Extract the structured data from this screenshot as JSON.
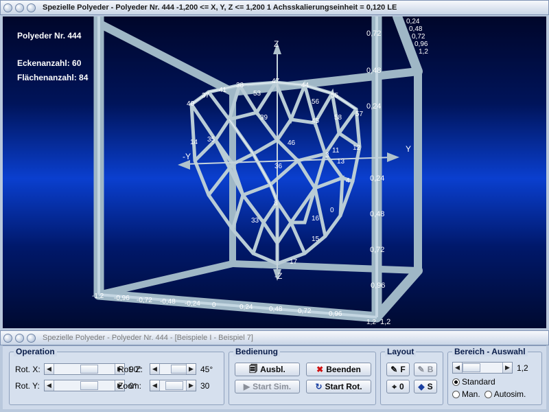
{
  "window": {
    "title": "Spezielle Polyeder - Polyeder Nr. 444   -1,200 <= X, Y, Z <= 1,200    1 Achsskalierungseinheit = 0,120 LE"
  },
  "info": {
    "polyeder": "Polyeder Nr. 444",
    "ecken": "Eckenanzahl: 60",
    "flaechen": "Flächenanzahl: 84"
  },
  "axes": {
    "y_label": "Y",
    "neg_y_label": "-Y",
    "z_label": "Z",
    "neg_z_label": "-Z",
    "right_ticks": [
      "0,72",
      "0,48",
      "0,24",
      "0,24",
      "0,48",
      "0,72",
      "0,96",
      "1,2"
    ],
    "top_right_ticks": [
      "0,24",
      "0,48",
      "0,72",
      "0,96",
      "1,2"
    ],
    "bottom_ticks": [
      "-1,2",
      "-0,96",
      "-0,72",
      "-0,48",
      "-0,24",
      "0",
      "0,24",
      "0,48",
      "0,72",
      "0,96",
      "1,2"
    ]
  },
  "vertex_labels": [
    "37",
    "41",
    "38",
    "53",
    "47",
    "44",
    "55",
    "40",
    "56",
    "57",
    "39",
    "58",
    "45",
    "14",
    "35",
    "46",
    "12",
    "11",
    "13",
    "36",
    "4",
    "33",
    "16",
    "15",
    "17",
    "0",
    "8",
    "3"
  ],
  "panel": {
    "window_title": "Spezielle Polyeder - Polyeder Nr. 444 - [Beispiele I - Beispiel 7]",
    "operation": {
      "title": "Operation",
      "rot_x_label": "Rot. X:",
      "rot_x_value": "90°",
      "rot_y_label": "Rot. Y:",
      "rot_y_value": "0°",
      "rot_z_label": "Rot. Z:",
      "rot_z_value": "45°",
      "zoom_label": "Zoom:",
      "zoom_value": "30"
    },
    "bedienung": {
      "title": "Bedienung",
      "ausbl": "Ausbl.",
      "beenden": "Beenden",
      "start_sim": "Start Sim.",
      "start_rot": "Start Rot."
    },
    "layout": {
      "title": "Layout",
      "f": "F",
      "b": "B",
      "o": "0",
      "s": "S"
    },
    "bereich": {
      "title": "Bereich - Auswahl",
      "value": "1,2",
      "standard": "Standard",
      "man": "Man.",
      "autosim": "Autosim."
    }
  }
}
